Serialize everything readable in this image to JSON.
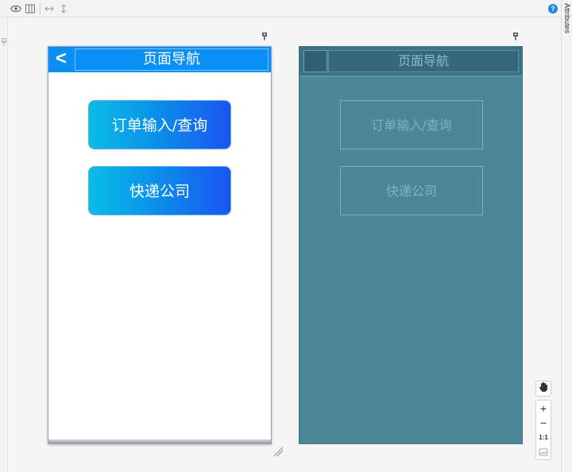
{
  "toolbar": {
    "icons": [
      "eye-icon",
      "columns-icon",
      "horizontal-resize-icon",
      "vertical-resize-icon"
    ],
    "help_label": "?"
  },
  "attributes_panel": {
    "label": "Attributes"
  },
  "design_view": {
    "navbar": {
      "back_label": "<",
      "title": "页面导航",
      "color": "#0a8ff5"
    },
    "buttons": [
      {
        "label": "订单输入/查询"
      },
      {
        "label": "快递公司"
      }
    ],
    "button_gradient": [
      "#0bbde6",
      "#1a55f0"
    ]
  },
  "preview_view": {
    "navbar": {
      "title": "页面导航"
    },
    "buttons": [
      {
        "label": "订单输入/查询"
      },
      {
        "label": "快递公司"
      }
    ],
    "overlay_color": "#4c8798"
  },
  "zoom_controls": {
    "zoom_in": "+",
    "zoom_out": "−",
    "actual_size": "1:1"
  }
}
